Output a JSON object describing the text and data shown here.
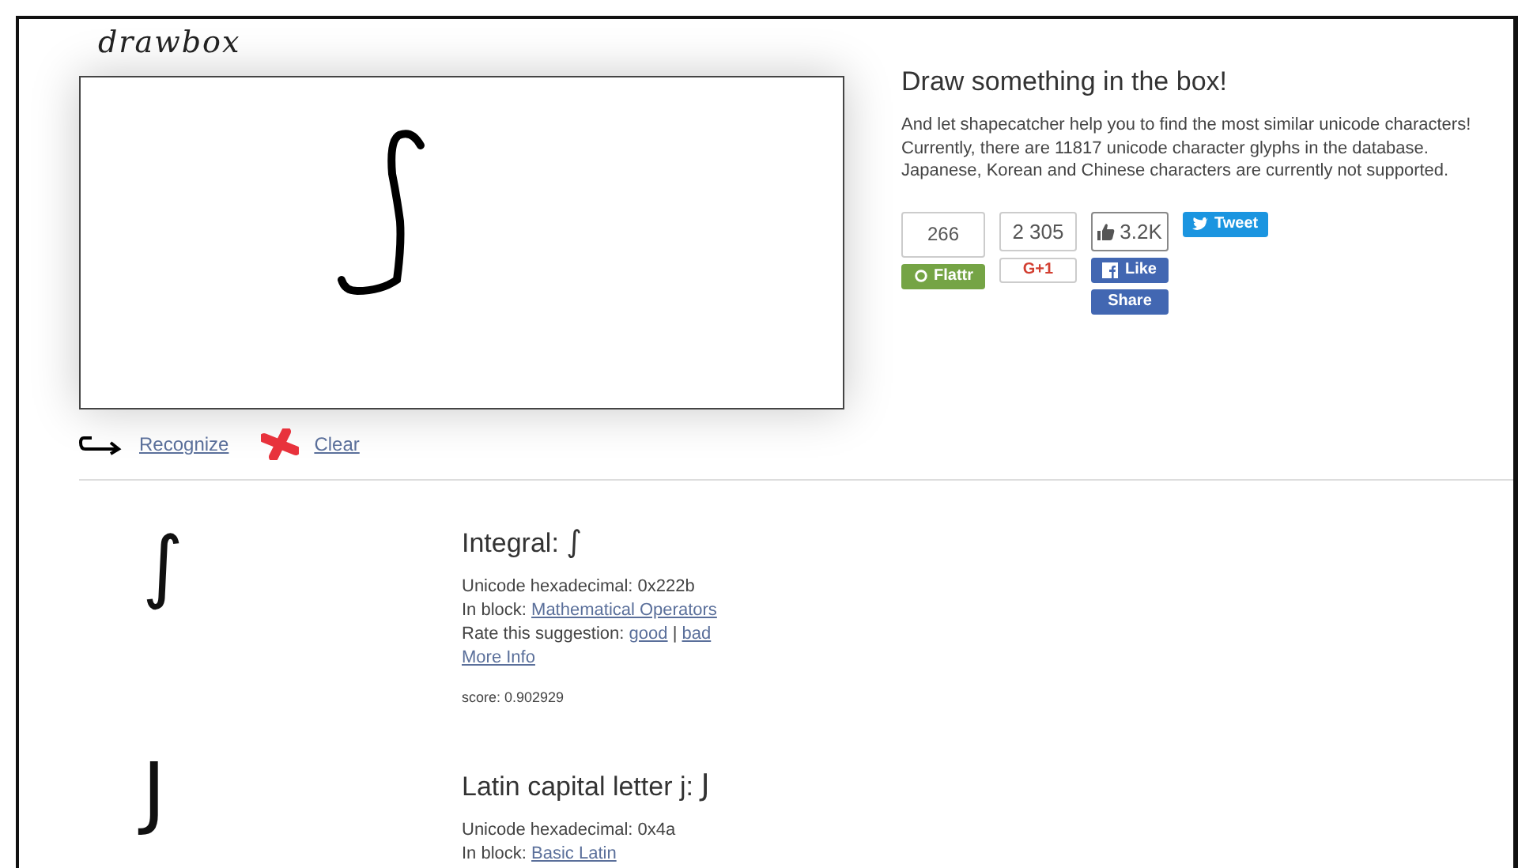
{
  "logo": "drawbox",
  "actions": [
    {
      "kind": "recognize",
      "label": "Recognize"
    },
    {
      "kind": "clear",
      "label": "Clear"
    }
  ],
  "intro": {
    "title": "Draw something in the box!",
    "lines": [
      "And let shapecatcher help you to find the most similar unicode characters!",
      "Currently, there are 11817 unicode character glyphs in the database.",
      "Japanese, Korean and Chinese characters are currently not supported."
    ]
  },
  "social": [
    {
      "kind": "flattr",
      "count": "266",
      "label": "Flattr"
    },
    {
      "kind": "gplus",
      "count": "2 305",
      "label": "G+1"
    },
    {
      "kind": "facebook",
      "count": "3.2K",
      "label": "Like",
      "extra": "Share"
    },
    {
      "kind": "twitter",
      "label": "Tweet"
    }
  ],
  "results": [
    {
      "glyph": "∫",
      "name": "Integral:",
      "char": "∫",
      "hex": "Unicode hexadecimal: 0x222b",
      "block_label": "In block:",
      "block": "Mathematical Operators",
      "rate_label": "Rate this suggestion:",
      "good": "good",
      "separator": "|",
      "bad": "bad",
      "more": "More Info",
      "score": "score: 0.902929"
    },
    {
      "glyph": "J",
      "name": "Latin capital letter j:",
      "char": "J",
      "hex": "Unicode hexadecimal: 0x4a",
      "block_label": "In block:",
      "block": "Basic Latin"
    }
  ]
}
